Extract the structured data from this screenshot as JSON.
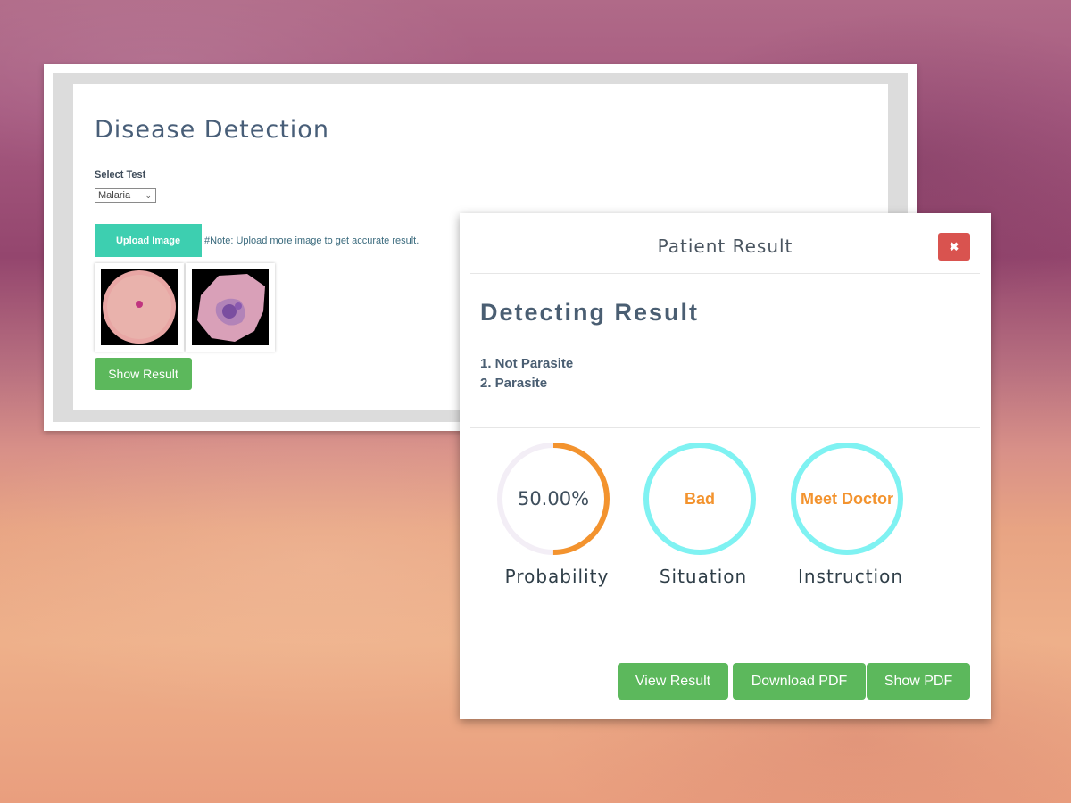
{
  "app": {
    "title": "Disease Detection",
    "select_label": "Select Test",
    "select_value": "Malaria",
    "upload_button": "Upload Image",
    "upload_note": "#Note: Upload more image to get accurate result.",
    "show_result_button": "Show Result",
    "images": [
      {
        "name": "uninfected-cell-image"
      },
      {
        "name": "parasitized-cell-image"
      }
    ]
  },
  "modal": {
    "title": "Patient Result",
    "close_icon": "times-icon",
    "heading": "Detecting Result",
    "results": [
      "1. Not Parasite",
      "2. Parasite"
    ],
    "metrics": [
      {
        "label": "Probability",
        "value": "50.00%",
        "fraction": 0.5,
        "color": "#f3932e",
        "track_color": "#f3eef6"
      },
      {
        "label": "Situation",
        "value": "Bad",
        "color": "#7ff2f2"
      },
      {
        "label": "Instruction",
        "value": "Meet Doctor",
        "color": "#7ff2f2"
      }
    ],
    "buttons": {
      "view": "View Result",
      "download": "Download PDF",
      "show": "Show PDF"
    }
  },
  "colors": {
    "teal_button": "#3dcfb0",
    "success_green": "#5cb85c",
    "danger_red": "#d9534f",
    "accent_orange": "#f3932e",
    "ring_cyan": "#7ff2f2"
  }
}
